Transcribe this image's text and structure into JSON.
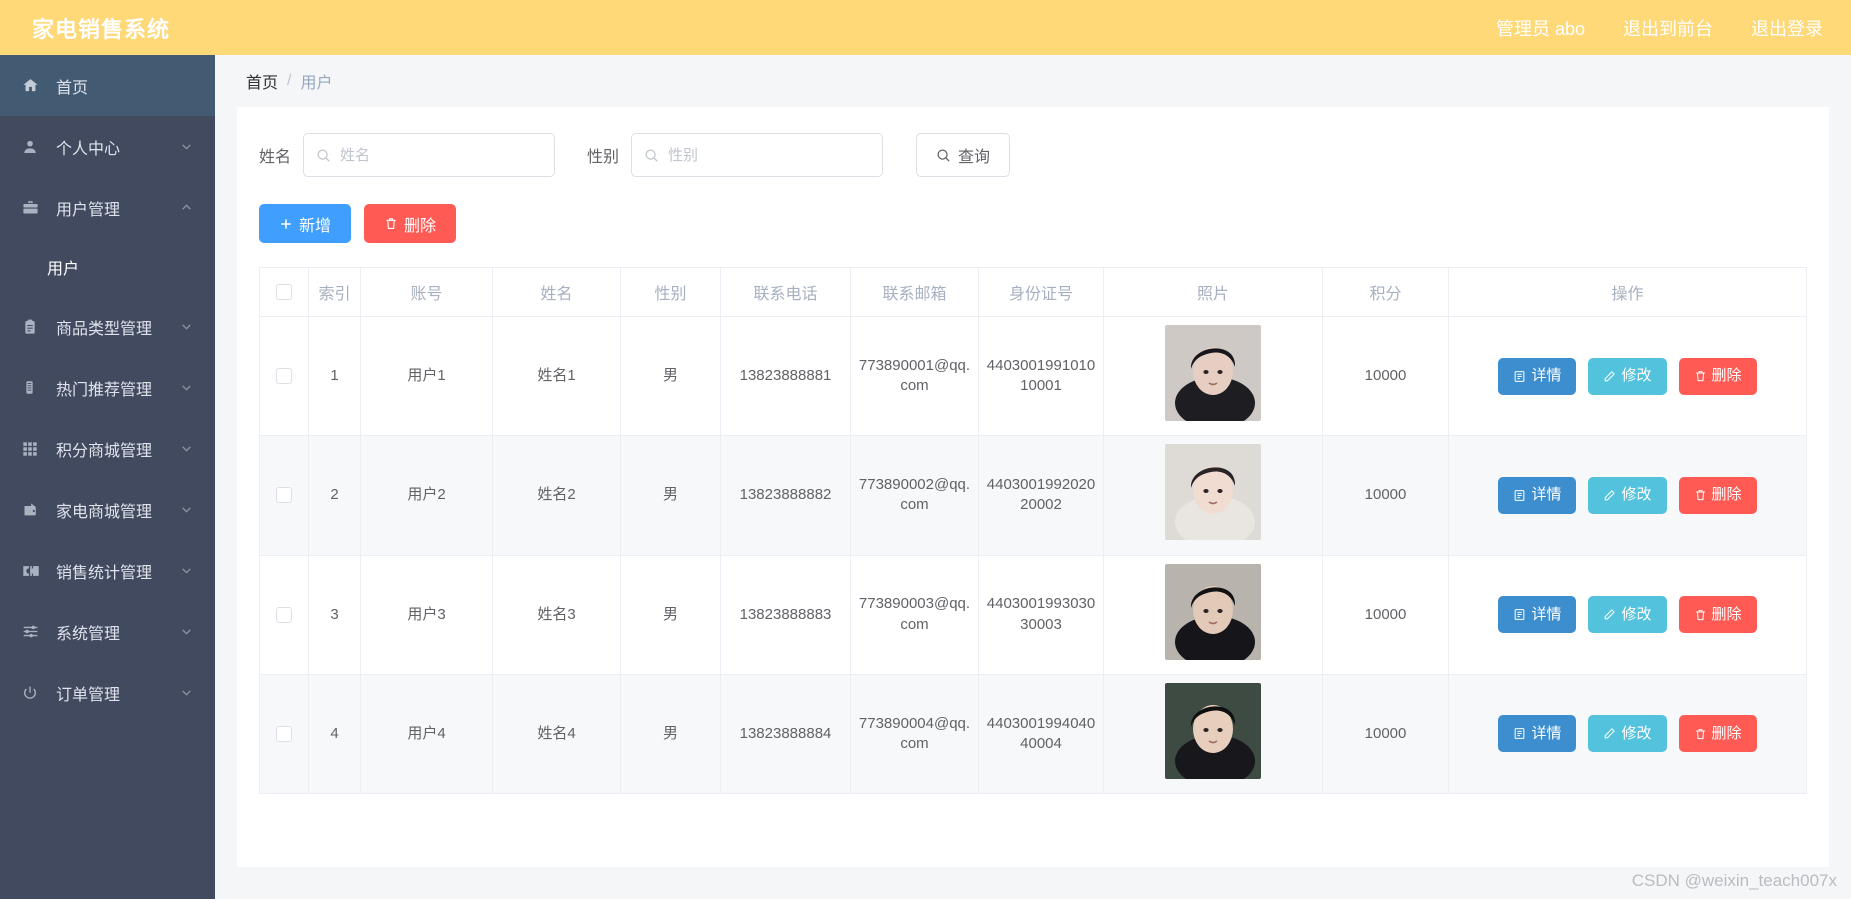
{
  "header": {
    "brand": "家电销售系统",
    "links": [
      {
        "label": "管理员 abo",
        "name": "admin-user"
      },
      {
        "label": "退出到前台",
        "name": "exit-to-front"
      },
      {
        "label": "退出登录",
        "name": "logout"
      }
    ]
  },
  "sidebar": {
    "items": [
      {
        "label": "首页",
        "icon": "home-icon",
        "active": true,
        "arrow": ""
      },
      {
        "label": "个人中心",
        "icon": "user-icon",
        "active": false,
        "arrow": "down"
      },
      {
        "label": "用户管理",
        "icon": "briefcase-icon",
        "active": false,
        "arrow": "up"
      },
      {
        "label": "商品类型管理",
        "icon": "clipboard-icon",
        "active": false,
        "arrow": "down"
      },
      {
        "label": "热门推荐管理",
        "icon": "server-icon",
        "active": false,
        "arrow": "down"
      },
      {
        "label": "积分商城管理",
        "icon": "grid-icon",
        "active": false,
        "arrow": "down"
      },
      {
        "label": "家电商城管理",
        "icon": "wallet-icon",
        "active": false,
        "arrow": "down"
      },
      {
        "label": "销售统计管理",
        "icon": "ticket-icon",
        "active": false,
        "arrow": "down"
      },
      {
        "label": "系统管理",
        "icon": "sliders-icon",
        "active": false,
        "arrow": "down"
      },
      {
        "label": "订单管理",
        "icon": "power-icon",
        "active": false,
        "arrow": "down"
      }
    ],
    "submenu": {
      "label": "用户"
    }
  },
  "breadcrumb": {
    "home": "首页",
    "separator": "/",
    "current": "用户"
  },
  "search": {
    "name_label": "姓名",
    "name_value": "",
    "name_placeholder": "姓名",
    "sex_label": "性别",
    "sex_value": "",
    "sex_placeholder": "性别",
    "query_button": "查询"
  },
  "toolbar": {
    "add_label": "新增",
    "delete_label": "删除"
  },
  "table": {
    "columns": [
      "",
      "索引",
      "账号",
      "姓名",
      "性别",
      "联系电话",
      "联系邮箱",
      "身份证号",
      "照片",
      "积分",
      "操作"
    ],
    "row_actions": {
      "detail": "详情",
      "edit": "修改",
      "remove": "删除"
    },
    "rows": [
      {
        "index": "1",
        "account": "用户1",
        "name": "姓名1",
        "sex": "男",
        "phone": "13823888881",
        "email": "773890001@qq.com",
        "idcard": "440300199101010001",
        "points": "10000",
        "photo": "portrait-1"
      },
      {
        "index": "2",
        "account": "用户2",
        "name": "姓名2",
        "sex": "男",
        "phone": "13823888882",
        "email": "773890002@qq.com",
        "idcard": "440300199202020002",
        "points": "10000",
        "photo": "portrait-2"
      },
      {
        "index": "3",
        "account": "用户3",
        "name": "姓名3",
        "sex": "男",
        "phone": "13823888883",
        "email": "773890003@qq.com",
        "idcard": "440300199303030003",
        "points": "10000",
        "photo": "portrait-3"
      },
      {
        "index": "4",
        "account": "用户4",
        "name": "姓名4",
        "sex": "男",
        "phone": "13823888884",
        "email": "773890004@qq.com",
        "idcard": "440300199404040004",
        "points": "10000",
        "photo": "portrait-4"
      }
    ]
  },
  "watermark": "CSDN @weixin_teach007x",
  "colors": {
    "header_bg": "#ffd978",
    "sidebar_bg": "#414a5e",
    "sidebar_active": "#435b72",
    "primary": "#409eff",
    "danger": "#ff5b54",
    "detail": "#3d8ecf",
    "edit": "#52c2dd"
  }
}
